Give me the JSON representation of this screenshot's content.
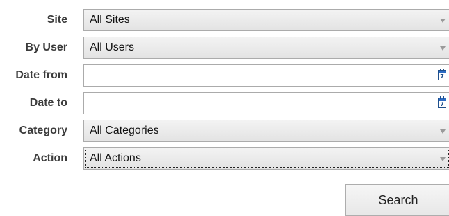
{
  "form": {
    "site": {
      "label": "Site",
      "value": "All Sites"
    },
    "by_user": {
      "label": "By User",
      "value": "All Users"
    },
    "date_from": {
      "label": "Date from",
      "value": "",
      "calendar_glyph": "7"
    },
    "date_to": {
      "label": "Date to",
      "value": "",
      "calendar_glyph": "7"
    },
    "category": {
      "label": "Category",
      "value": "All Categories"
    },
    "action": {
      "label": "Action",
      "value": "All Actions"
    }
  },
  "buttons": {
    "search_label": "Search"
  },
  "icons": {
    "dropdown": "chevron-down-icon",
    "date_picker": "calendar-icon"
  },
  "colors": {
    "label_text": "#3c3c3c",
    "control_border": "#ababab",
    "calendar_icon": "#2d6cc4"
  }
}
